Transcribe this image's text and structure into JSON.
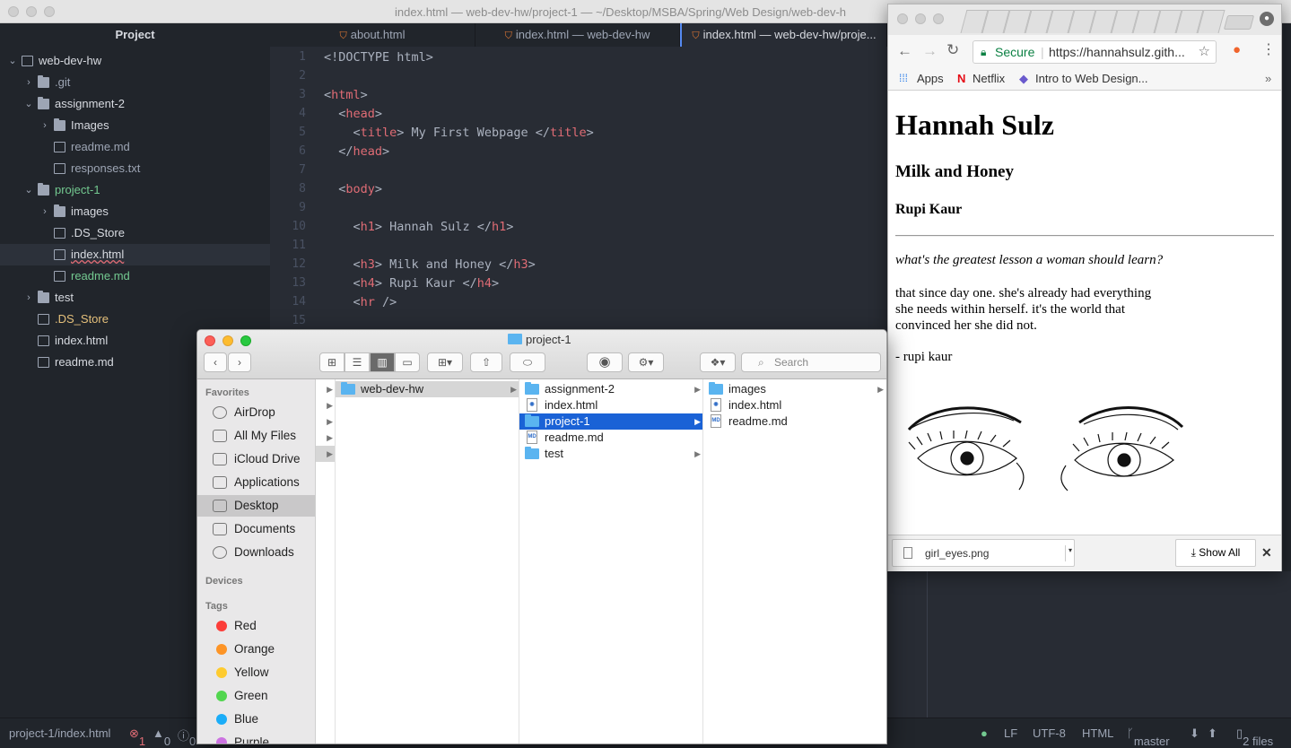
{
  "atom": {
    "window_title": "index.html — web-dev-hw/project-1 — ~/Desktop/MSBA/Spring/Web Design/web-dev-h",
    "sidebar_title": "Project",
    "tree": [
      {
        "label": "web-dev-hw"
      },
      {
        "label": ".git"
      },
      {
        "label": "assignment-2"
      },
      {
        "label": "Images"
      },
      {
        "label": "readme.md"
      },
      {
        "label": "responses.txt"
      },
      {
        "label": "project-1"
      },
      {
        "label": "images"
      },
      {
        "label": ".DS_Store"
      },
      {
        "label": "index.html"
      },
      {
        "label": "readme.md"
      },
      {
        "label": "test"
      },
      {
        "label": ".DS_Store"
      },
      {
        "label": "index.html"
      },
      {
        "label": "readme.md"
      }
    ],
    "tabs": [
      {
        "label": "about.html"
      },
      {
        "label": "index.html — web-dev-hw"
      },
      {
        "label": "index.html — web-dev-hw/proje..."
      }
    ],
    "line_numbers": [
      "1",
      "2",
      "3",
      "4",
      "5",
      "6",
      "7",
      "8",
      "9",
      "10",
      "11",
      "12",
      "13",
      "14",
      "15"
    ],
    "code": {
      "l1": "<!DOCTYPE html>",
      "l3a": "<",
      "l3t": "html",
      "l3b": ">",
      "l4a": "  <",
      "l4t": "head",
      "l4b": ">",
      "l5a": "    <",
      "l5t": "title",
      "l5b": "> My First Webpage </",
      "l5t2": "title",
      "l5c": ">",
      "l6a": "  </",
      "l6t": "head",
      "l6b": ">",
      "l8a": "  <",
      "l8t": "body",
      "l8b": ">",
      "l10a": "    <",
      "l10t": "h1",
      "l10b": "> Hannah Sulz </",
      "l10t2": "h1",
      "l10c": ">",
      "l12a": "    <",
      "l12t": "h3",
      "l12b": "> Milk and Honey </",
      "l12t2": "h3",
      "l12c": ">",
      "l13a": "    <",
      "l13t": "h4",
      "l13b": "> Rupi Kaur </",
      "l13t2": "h4",
      "l13c": ">",
      "l14a": "    <",
      "l14t": "hr",
      "l14b": " />"
    },
    "status": {
      "path": "project-1/index.html",
      "errors": "1",
      "warnings": "0",
      "infos": "0",
      "eol": "LF",
      "encoding": "UTF-8",
      "grammar": "HTML",
      "branch": "master",
      "files": "2 files"
    }
  },
  "chrome": {
    "secure_label": "Secure",
    "url": "https://hannahsulz.gith...",
    "bookmarks": [
      "Apps",
      "Netflix",
      "Intro to Web Design..."
    ],
    "page": {
      "h1": "Hannah Sulz",
      "h3": "Milk and Honey",
      "h4": "Rupi Kaur",
      "question": "what's the greatest lesson a woman should learn?",
      "poem": [
        "that since day one. she's already had everything",
        "she needs within herself. it's the world that",
        "convinced her she did not."
      ],
      "author": "- rupi kaur"
    },
    "download": {
      "filename": "girl_eyes.png",
      "show_all": "Show All"
    }
  },
  "finder": {
    "title": "project-1",
    "search_placeholder": "Search",
    "favorites_header": "Favorites",
    "favorites": [
      "AirDrop",
      "All My Files",
      "iCloud Drive",
      "Applications",
      "Desktop",
      "Documents",
      "Downloads"
    ],
    "devices_header": "Devices",
    "tags_header": "Tags",
    "tags": [
      {
        "name": "Red",
        "color": "#fc3d39"
      },
      {
        "name": "Orange",
        "color": "#fd9426"
      },
      {
        "name": "Yellow",
        "color": "#fecb2f"
      },
      {
        "name": "Green",
        "color": "#52d64f"
      },
      {
        "name": "Blue",
        "color": "#1badf8"
      },
      {
        "name": "Purple",
        "color": "#cc73e1"
      }
    ],
    "col1": [
      "web-dev-hw"
    ],
    "col2": [
      "assignment-2",
      "index.html",
      "project-1",
      "readme.md",
      "test"
    ],
    "col3": [
      "images",
      "index.html",
      "readme.md"
    ]
  }
}
